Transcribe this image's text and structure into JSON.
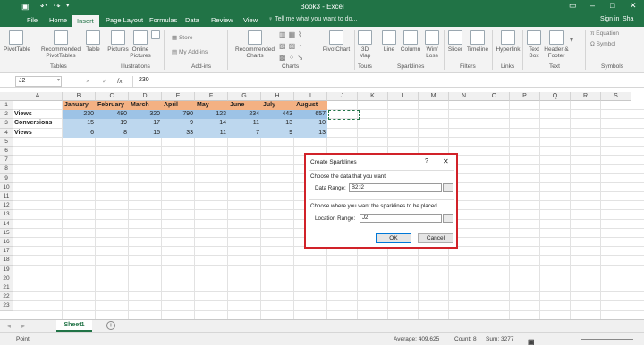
{
  "window": {
    "title": "Book3 - Excel",
    "sign_in": "Sign in",
    "share": "Sha"
  },
  "tabs": [
    "File",
    "Home",
    "Insert",
    "Page Layout",
    "Formulas",
    "Data",
    "Review",
    "View"
  ],
  "active_tab": "Insert",
  "tell_me": "Tell me what you want to do...",
  "ribbon": {
    "pivottable": "PivotTable",
    "recommended_pivottables": "Recommended PivotTables",
    "table": "Table",
    "pictures": "Pictures",
    "online_pictures": "Online Pictures",
    "store": "Store",
    "my_addins": "My Add-ins",
    "recommended_charts": "Recommended Charts",
    "pivotchart": "PivotChart",
    "map3d": "3D Map",
    "line": "Line",
    "column": "Column",
    "winloss": "Win/ Loss",
    "slicer": "Slicer",
    "timeline": "Timeline",
    "hyperlink": "Hyperlink",
    "text_box": "Text Box",
    "header_footer": "Header & Footer",
    "equation": "Equation",
    "symbol": "Symbol",
    "groups": {
      "tables": "Tables",
      "illustrations": "Illustrations",
      "addins": "Add-ins",
      "charts": "Charts",
      "tours": "Tours",
      "sparklines": "Sparklines",
      "filters": "Filters",
      "links": "Links",
      "text": "Text",
      "symbols": "Symbols"
    }
  },
  "formula_bar": {
    "name_box": "J2",
    "cancel": "×",
    "enter": "✓",
    "fx": "fx",
    "value": "230"
  },
  "columns": [
    "A",
    "B",
    "C",
    "D",
    "E",
    "F",
    "G",
    "H",
    "I",
    "J",
    "K",
    "L",
    "M",
    "N",
    "O",
    "P",
    "Q",
    "R",
    "S"
  ],
  "rows": [
    "1",
    "2",
    "3",
    "4",
    "5",
    "6",
    "7",
    "8",
    "9",
    "10",
    "11",
    "12",
    "13",
    "14",
    "15",
    "16",
    "17",
    "18",
    "19",
    "20",
    "21",
    "22",
    "23"
  ],
  "sheet": {
    "months": [
      "January",
      "February",
      "March",
      "April",
      "May",
      "June",
      "July",
      "August"
    ],
    "data": [
      {
        "label": "Views",
        "values": [
          "230",
          "480",
          "320",
          "790",
          "123",
          "234",
          "443",
          "657"
        ]
      },
      {
        "label": "Conversions",
        "values": [
          "15",
          "19",
          "17",
          "9",
          "14",
          "11",
          "13",
          "10"
        ]
      },
      {
        "label": "Views",
        "values": [
          "6",
          "8",
          "15",
          "33",
          "11",
          "7",
          "9",
          "13"
        ]
      }
    ]
  },
  "sheet_tabs": [
    "Sheet1"
  ],
  "add_sheet": "+",
  "status": {
    "mode": "Point",
    "average": "Average: 409.625",
    "count": "Count: 8",
    "sum": "Sum: 3277"
  },
  "dialog": {
    "title": "Create Sparklines",
    "help": "?",
    "close": "✕",
    "section1": "Choose the data that you want",
    "data_range_label": "Data Range:",
    "data_range_value": "B2:I2",
    "section2": "Choose where you want the sparklines to be placed",
    "location_range_label": "Location Range:",
    "location_range_value": "J2",
    "ok": "OK",
    "cancel": "Cancel"
  },
  "colors": {
    "excel_green": "#217346",
    "header_orange": "#f4b183",
    "row_blue": "#9dc3e6",
    "row_light_blue": "#bdd7ee",
    "dialog_border": "#d12229"
  }
}
